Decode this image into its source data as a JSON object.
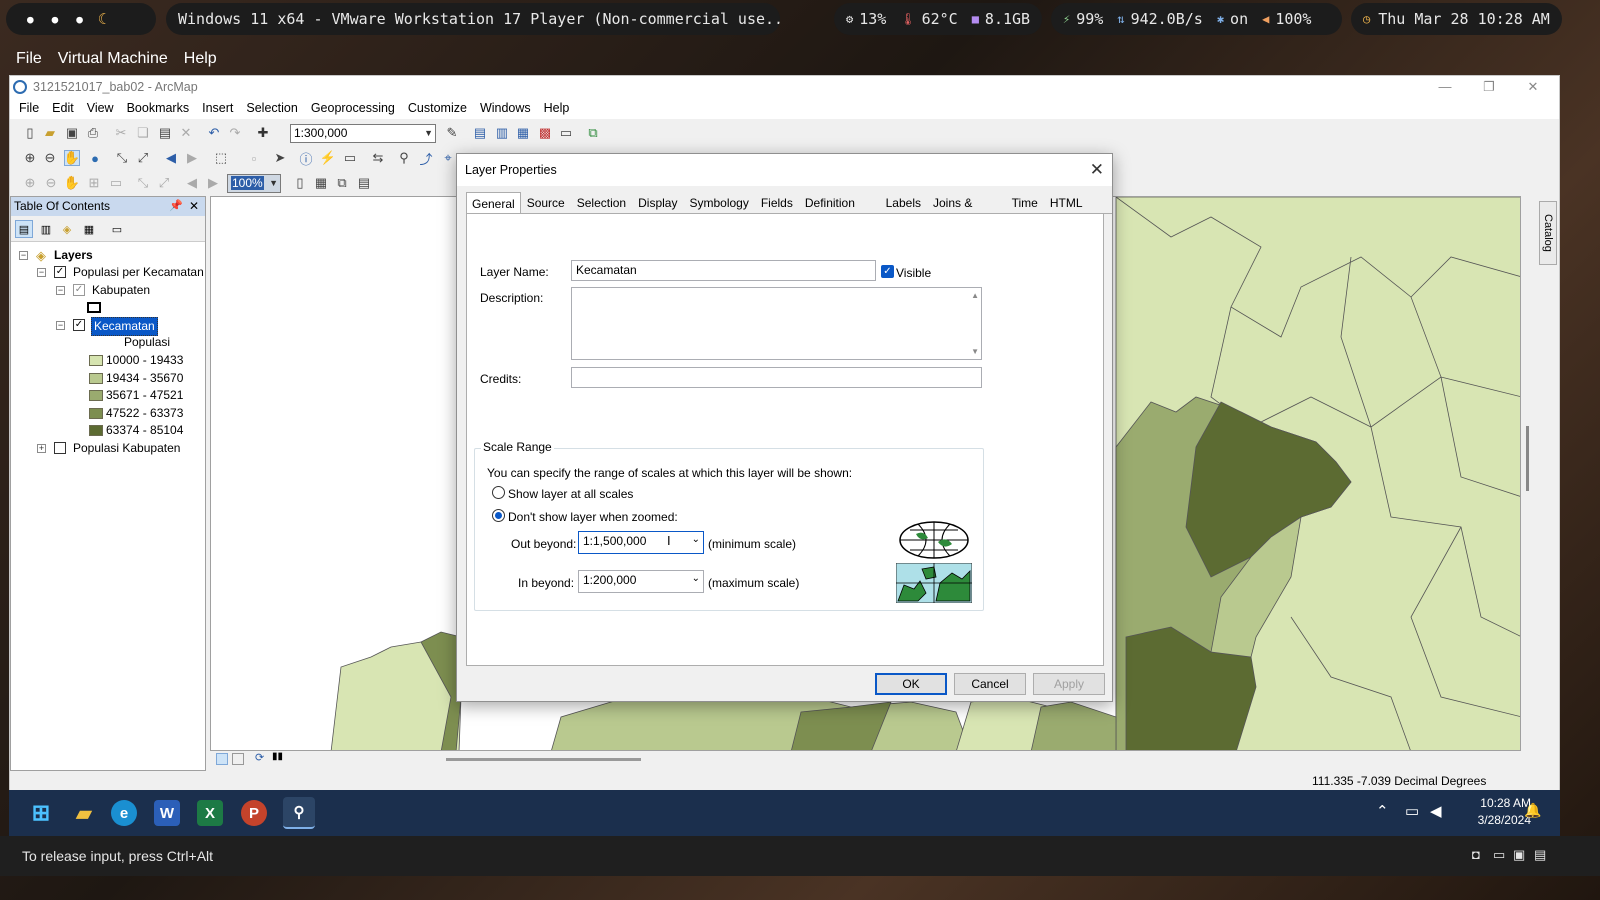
{
  "topbar": {
    "vm_title": "Windows 11 x64 - VMware Workstation 17 Player (Non-commercial use...",
    "cpu": "13%",
    "temp": "62°C",
    "mem": "8.1GB",
    "battery": "99%",
    "net": "942.0B/s",
    "bt": "on",
    "volume": "100%",
    "clock": "Thu Mar 28 10:28 AM"
  },
  "vmmenu": [
    "File",
    "Virtual Machine",
    "Help"
  ],
  "arcmap": {
    "title": "3121521017_bab02 - ArcMap",
    "menu": [
      "File",
      "Edit",
      "View",
      "Bookmarks",
      "Insert",
      "Selection",
      "Geoprocessing",
      "Customize",
      "Windows",
      "Help"
    ],
    "scale_value": "1:300,000",
    "zoom_value": "100%"
  },
  "toc": {
    "title": "Table Of Contents",
    "root": "Layers",
    "group1": "Populasi per Kecamatan",
    "kabupaten": "Kabupaten",
    "kecamatan": "Kecamatan",
    "field": "Populasi",
    "classes": [
      {
        "label": "10000 - 19433",
        "color": "#d6e4b0"
      },
      {
        "label": "19434 - 35670",
        "color": "#b9c98f"
      },
      {
        "label": "35671 - 47521",
        "color": "#9aab6f"
      },
      {
        "label": "47522 - 63373",
        "color": "#7d8e50"
      },
      {
        "label": "63374 - 85104",
        "color": "#5c6b32"
      }
    ],
    "group2": "Populasi Kabupaten"
  },
  "status": {
    "coords": "111.335  -7.039 Decimal Degrees"
  },
  "catalog_tab": "Catalog",
  "dialog": {
    "title": "Layer Properties",
    "tabs": [
      "General",
      "Source",
      "Selection",
      "Display",
      "Symbology",
      "Fields",
      "Definition Query",
      "Labels",
      "Joins & Relates",
      "Time",
      "HTML Popup"
    ],
    "layer_name_label": "Layer Name:",
    "layer_name_value": "Kecamatan",
    "visible_label": "Visible",
    "description_label": "Description:",
    "credits_label": "Credits:",
    "scale_range_caption": "Scale Range",
    "scale_hint": "You can specify the range of scales at which this layer will be shown:",
    "radio_all": "Show layer at all scales",
    "radio_zoomed": "Don't show layer when zoomed:",
    "out_beyond_label": "Out beyond:",
    "out_beyond_value": "1:1,500,000",
    "min_scale_label": "(minimum scale)",
    "in_beyond_label": "In beyond:",
    "in_beyond_value": "1:200,000",
    "max_scale_label": "(maximum scale)",
    "ok": "OK",
    "cancel": "Cancel",
    "apply": "Apply"
  },
  "taskbar": {
    "time": "10:28 AM",
    "date": "3/28/2024"
  },
  "bottom_hint": "To release input, press Ctrl+Alt"
}
